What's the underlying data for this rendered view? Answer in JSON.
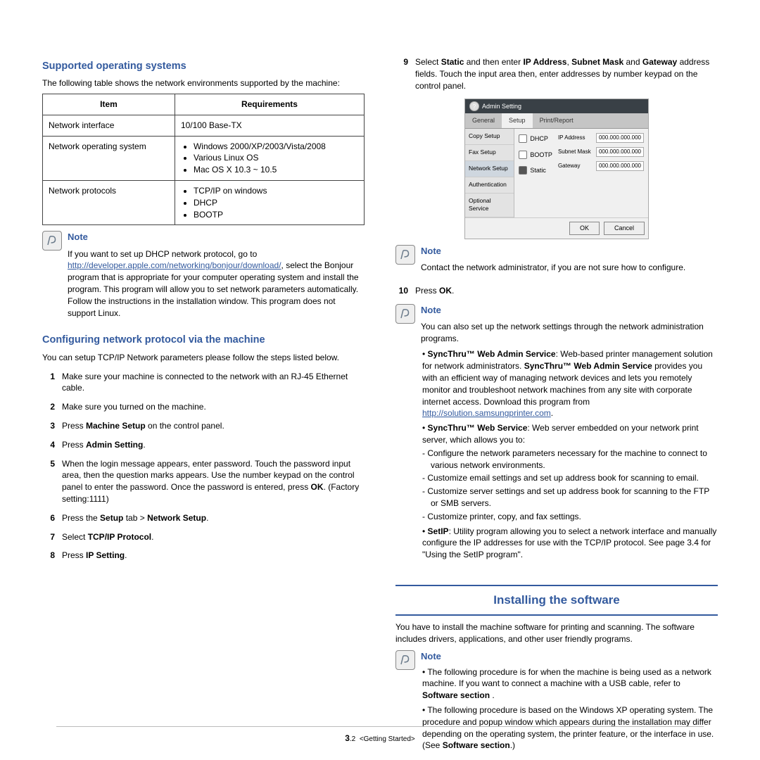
{
  "left": {
    "h1": "Supported operating systems",
    "intro": "The following table shows the network environments supported by the machine:",
    "th1": "Item",
    "th2": "Requirements",
    "r1c1": "Network interface",
    "r1c2": "10/100 Base-TX",
    "r2c1": "Network operating system",
    "r2b1": "Windows 2000/XP/2003/Vista/2008",
    "r2b2": "Various Linux OS",
    "r2b3": "Mac OS X 10.3 ~ 10.5",
    "r3c1": "Network protocols",
    "r3b1": "TCP/IP on windows",
    "r3b2": "DHCP",
    "r3b3": "BOOTP",
    "note_t": "Note",
    "note1a": "If you want to set up DHCP network protocol, go to ",
    "note_link": "http://developer.apple.com/networking/bonjour/download/",
    "note1b": ", select the Bonjour program that is appropriate for your computer operating system and install the program. This program will allow you to set network parameters automatically. Follow the instructions in the installation window. This program does not support Linux.",
    "h2": "Configuring network protocol via the machine",
    "h2p": "You can setup TCP/IP Network parameters please follow the steps listed below.",
    "s1": "Make sure your machine is connected to the network with an RJ-45 Ethernet cable.",
    "s2": "Make sure you turned on the machine.",
    "s3a": "Press ",
    "s3b": "Machine Setup",
    "s3c": " on the control panel.",
    "s4a": "Press ",
    "s4b": "Admin Setting",
    "s4c": ".",
    "s5a": "When the login message appears, enter password. Touch the password input area, then the question marks appears. Use the number keypad on the control panel to enter the password. Once the password is entered, press ",
    "s5b": "OK",
    "s5c": ". (Factory setting:1111)",
    "s6a": "Press the ",
    "s6b": "Setup",
    "s6c": " tab > ",
    "s6d": "Network Setup",
    "s6e": ".",
    "s7a": "Select ",
    "s7b": "TCP/IP Protocol",
    "s7c": ".",
    "s8a": "Press ",
    "s8b": "IP Setting",
    "s8c": "."
  },
  "right": {
    "s9a": "Select ",
    "s9b": "Static",
    "s9c": " and then enter ",
    "s9d": "IP Address",
    "s9e": ", ",
    "s9f": "Subnet Mask",
    "s9g": " and ",
    "s9h": "Gateway",
    "s9i": " address fields. Touch the input area then, enter addresses by number keypad on the control panel.",
    "shot": {
      "title": "Admin Setting",
      "tab1": "General",
      "tab2": "Setup",
      "tab3": "Print/Report",
      "side1": "Copy Setup",
      "side2": "Fax Setup",
      "side3": "Network Setup",
      "side4": "Authentication",
      "side5": "Optional Service",
      "r1": "DHCP",
      "r2": "BOOTP",
      "r3": "Static",
      "f1": "IP Address",
      "f2": "Subnet Mask",
      "f3": "Gateway",
      "v": "000.000.000.000",
      "ok": "OK",
      "cancel": "Cancel"
    },
    "note_t": "Note",
    "note1": "Contact the network administrator, if you are not sure how to configure.",
    "s10a": "Press ",
    "s10b": "OK",
    "s10c": ".",
    "note2_intro": "You can also set up the network settings through the network administration programs.",
    "b1a": "SyncThru™ Web Admin Service",
    "b1b": ": Web-based printer management solution for network administrators. ",
    "b1c": "SyncThru™ Web Admin Service",
    "b1d": " provides you with an efficient way of managing network devices and lets you remotely monitor and troubleshoot network machines from any site with corporate internet access. Download this program from ",
    "b1link": "http://solution.samsungprinter.com",
    "b2a": "SyncThru™ Web Service",
    "b2b": ": Web server embedded on your network print server, which allows you to:",
    "d1": "Configure the network parameters necessary for the machine to connect to various network environments.",
    "d2": "Customize email settings and set up address book for scanning to email.",
    "d3": "Customize server settings and set up address book for scanning to the FTP or SMB servers.",
    "d4": "Customize printer, copy, and fax settings.",
    "b3a": "SetIP",
    "b3b": ": Utility program allowing you to select a network interface and manually configure the IP addresses for use with the TCP/IP protocol. See  page 3.4 for \"Using the SetIP program\".",
    "h2": "Installing the software",
    "h2p": "You have to install the machine software for printing and scanning. The software includes drivers, applications, and other user friendly programs.",
    "n3a": "The following procedure is for when the machine is being used as a network machine. If you want to connect a machine with a USB cable, refer to ",
    "n3b": "Software section",
    "n3c": " .",
    "n4a": "The following procedure is based on the Windows XP operating system. The procedure and popup window which appears during the installation may differ depending on the operating system, the printer feature, or the interface in use. (See ",
    "n4b": "Software section",
    "n4c": ".)"
  },
  "footer": {
    "page": "3",
    "sub": ".2",
    "sec": "<Getting Started>"
  }
}
